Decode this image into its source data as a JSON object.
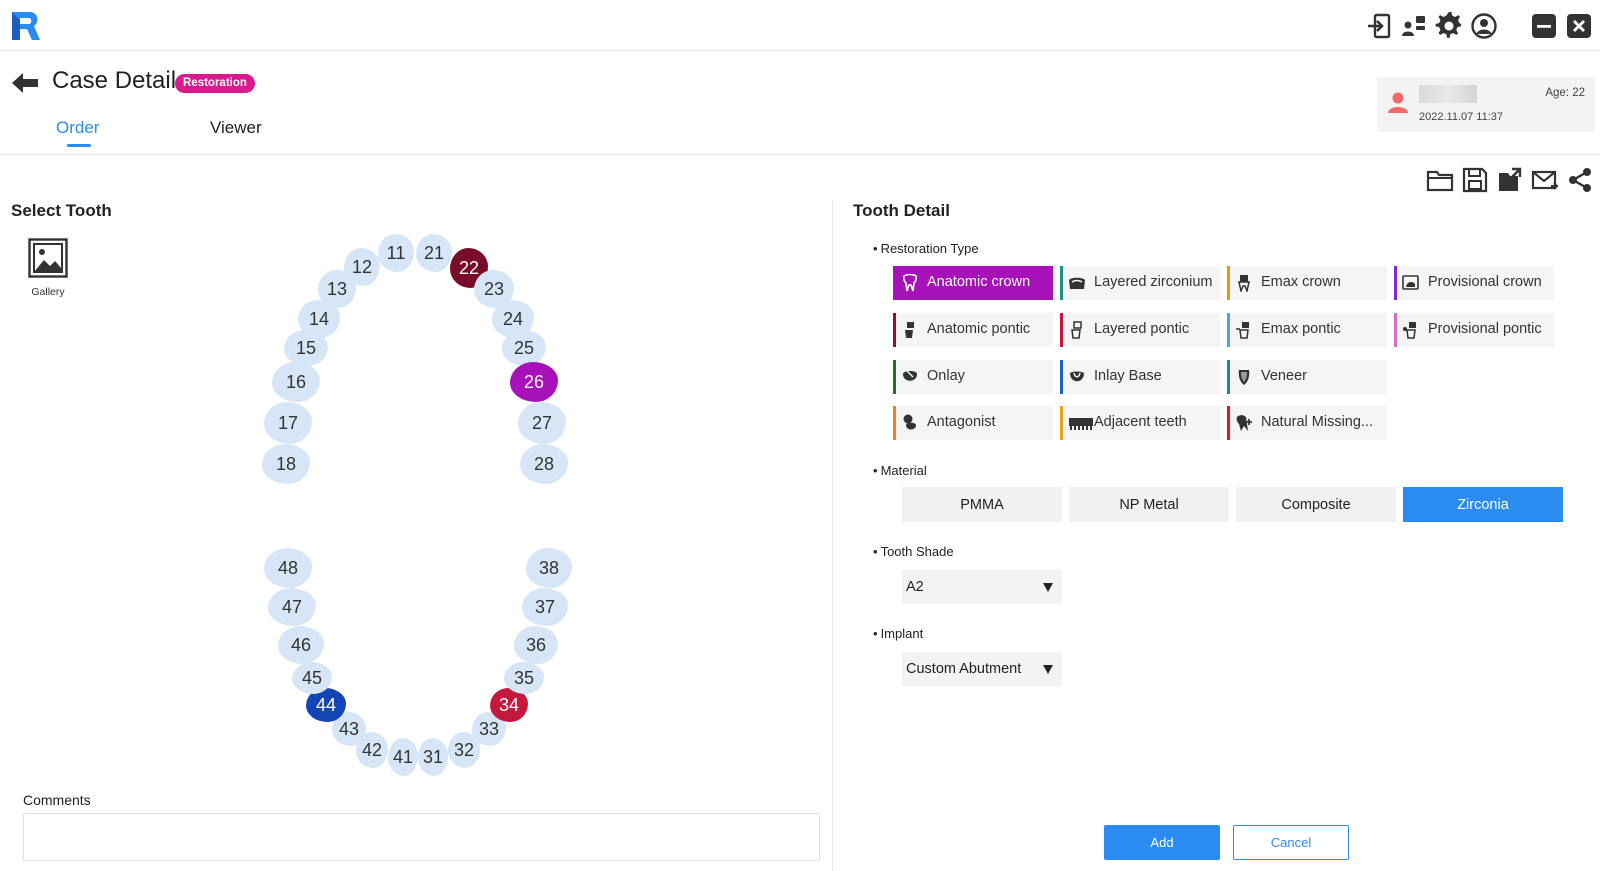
{
  "page": {
    "title": "Case Detail",
    "badge": "Restoration",
    "tabs": [
      {
        "label": "Order",
        "active": true
      },
      {
        "label": "Viewer",
        "active": false
      }
    ]
  },
  "patient": {
    "age": "Age: 22",
    "date": "2022.11.07 11:37"
  },
  "left": {
    "title": "Select Tooth",
    "gallery_label": "Gallery",
    "comments_label": "Comments",
    "comments_value": ""
  },
  "teeth": [
    {
      "num": "11"
    },
    {
      "num": "12"
    },
    {
      "num": "13"
    },
    {
      "num": "14"
    },
    {
      "num": "15"
    },
    {
      "num": "16"
    },
    {
      "num": "17"
    },
    {
      "num": "18"
    },
    {
      "num": "21"
    },
    {
      "num": "22",
      "color": "#7a0b2a"
    },
    {
      "num": "23"
    },
    {
      "num": "24"
    },
    {
      "num": "25"
    },
    {
      "num": "26",
      "color": "#a711b8"
    },
    {
      "num": "27"
    },
    {
      "num": "28"
    },
    {
      "num": "31"
    },
    {
      "num": "32"
    },
    {
      "num": "33"
    },
    {
      "num": "34",
      "color": "#c4183d"
    },
    {
      "num": "35"
    },
    {
      "num": "36"
    },
    {
      "num": "37"
    },
    {
      "num": "38"
    },
    {
      "num": "41"
    },
    {
      "num": "42"
    },
    {
      "num": "43"
    },
    {
      "num": "44",
      "color": "#1345b5"
    },
    {
      "num": "45"
    },
    {
      "num": "46"
    },
    {
      "num": "47"
    },
    {
      "num": "48"
    }
  ],
  "detail": {
    "title": "Tooth Detail",
    "restoration_type_label": "Restoration Type",
    "restoration_types": [
      {
        "label": "Anatomic crown",
        "accent": "#a711b8",
        "icon": "crown-icon",
        "active": true
      },
      {
        "label": "Layered zirconium",
        "accent": "#1f8f8a",
        "icon": "layered-crown-icon"
      },
      {
        "label": "Emax crown",
        "accent": "#d4a017",
        "icon": "emax-crown-icon"
      },
      {
        "label": "Provisional crown",
        "accent": "#7a2bd8",
        "icon": "provisional-crown-icon"
      },
      {
        "label": "Anatomic pontic",
        "accent": "#8a1530",
        "icon": "pontic-icon"
      },
      {
        "label": "Layered pontic",
        "accent": "#c4183d",
        "icon": "layered-pontic-icon"
      },
      {
        "label": "Emax pontic",
        "accent": "#4aa3e8",
        "icon": "emax-pontic-icon"
      },
      {
        "label": "Provisional pontic",
        "accent": "#d26fc4",
        "icon": "provisional-pontic-icon"
      },
      {
        "label": "Onlay",
        "accent": "#2a6b2a",
        "icon": "onlay-icon"
      },
      {
        "label": "Inlay Base",
        "accent": "#1b62c4",
        "icon": "inlay-icon"
      },
      {
        "label": "Veneer",
        "accent": "#1f8f8a",
        "icon": "veneer-icon"
      },
      {
        "label": "Antagonist",
        "accent": "#e8821b",
        "icon": "antagonist-icon"
      },
      {
        "label": "Adjacent teeth",
        "accent": "#e8a31b",
        "icon": "adjacent-teeth-icon"
      },
      {
        "label": "Natural Missing...",
        "accent": "#d81b2a",
        "icon": "missing-tooth-icon"
      }
    ],
    "material_label": "Material",
    "materials": [
      {
        "label": "PMMA"
      },
      {
        "label": "NP Metal"
      },
      {
        "label": "Composite"
      },
      {
        "label": "Zirconia",
        "active": true
      }
    ],
    "shade_label": "Tooth Shade",
    "shade_value": "A2",
    "implant_label": "Implant",
    "implant_value": "Custom Abutment",
    "add_label": "Add",
    "cancel_label": "Cancel"
  },
  "colors": {
    "accent": "#2a8cf0",
    "tooth_default": "#d6e6f7",
    "selected_type": "#a711b8"
  }
}
